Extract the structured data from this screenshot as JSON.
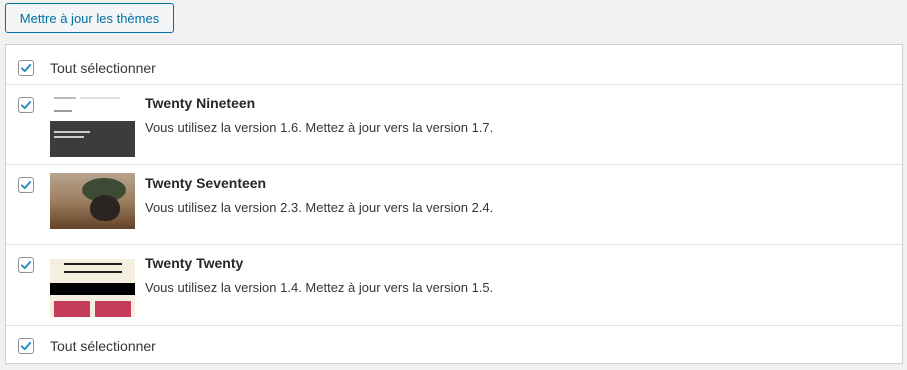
{
  "toolbar": {
    "update_button_label": "Mettre à jour les thèmes"
  },
  "table": {
    "select_all_label": "Tout sélectionner",
    "select_all_checked": true,
    "themes": [
      {
        "name": "Twenty Nineteen",
        "description": "Vous utilisez la version 1.6. Mettez à jour vers la version 1.7.",
        "checked": true
      },
      {
        "name": "Twenty Seventeen",
        "description": "Vous utilisez la version 2.3. Mettez à jour vers la version 2.4.",
        "checked": true
      },
      {
        "name": "Twenty Twenty",
        "description": "Vous utilisez la version 1.4. Mettez à jour vers la version 1.5.",
        "checked": true
      }
    ]
  },
  "colors": {
    "accent": "#0071a1",
    "check": "#1e8cbe"
  }
}
